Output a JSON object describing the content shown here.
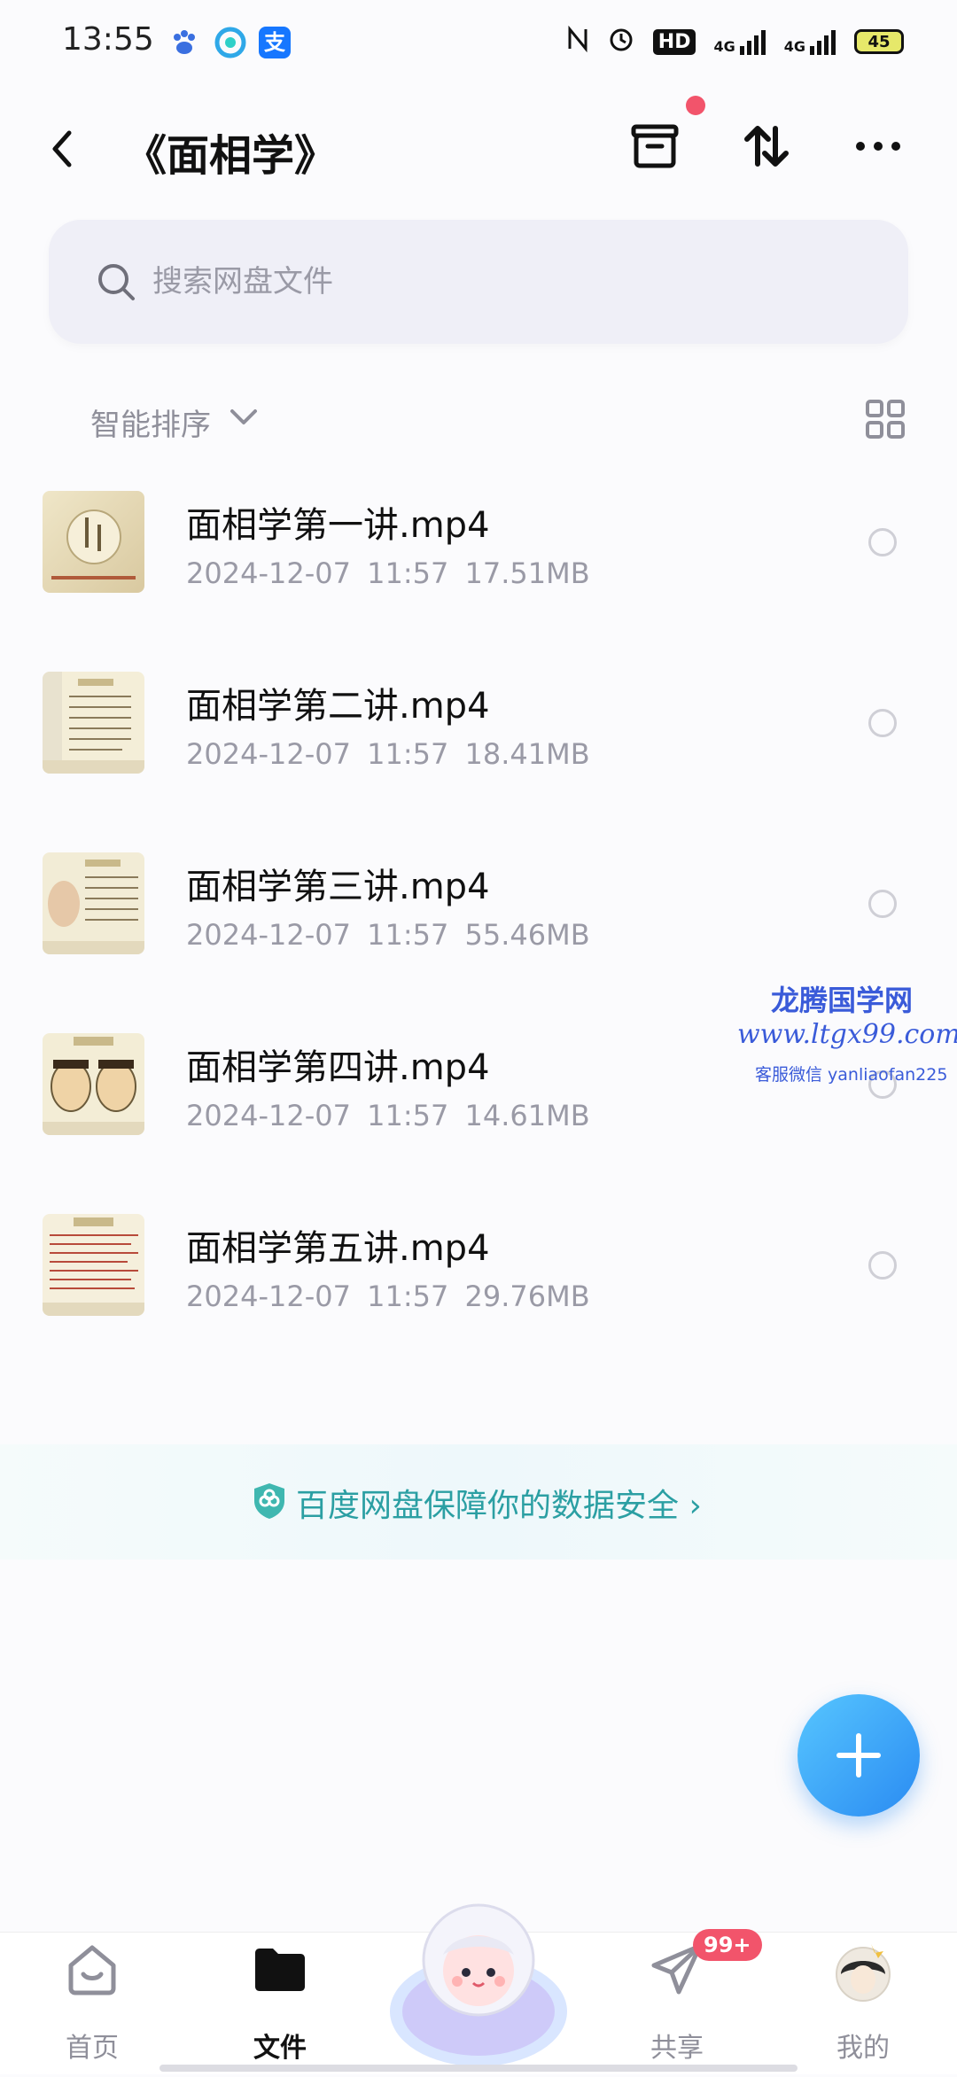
{
  "status_bar": {
    "time": "13:55",
    "hd_label": "HD",
    "net1": "4G",
    "net2": "4G",
    "battery": "45"
  },
  "header": {
    "title": "《面相学》"
  },
  "search": {
    "placeholder": "搜索网盘文件"
  },
  "sort": {
    "label": "智能排序"
  },
  "files": [
    {
      "name": "面相学第一讲.mp4",
      "date": "2024-12-07",
      "time": "11:57",
      "size": "17.51MB"
    },
    {
      "name": "面相学第二讲.mp4",
      "date": "2024-12-07",
      "time": "11:57",
      "size": "18.41MB"
    },
    {
      "name": "面相学第三讲.mp4",
      "date": "2024-12-07",
      "time": "11:57",
      "size": "55.46MB"
    },
    {
      "name": "面相学第四讲.mp4",
      "date": "2024-12-07",
      "time": "11:57",
      "size": "14.61MB"
    },
    {
      "name": "面相学第五讲.mp4",
      "date": "2024-12-07",
      "time": "11:57",
      "size": "29.76MB"
    }
  ],
  "watermark": {
    "title": "龙腾国学网",
    "url": "www.ltgx99.com",
    "contact": "客服微信 yanliaofan225"
  },
  "safety_banner": {
    "text": "百度网盘保障你的数据安全 ›"
  },
  "bottom_nav": {
    "items": [
      {
        "label": "首页"
      },
      {
        "label": "文件"
      },
      {
        "label": "共享",
        "badge": "99+"
      },
      {
        "label": "我的"
      }
    ]
  },
  "colors": {
    "accent_blue": "#2a8bf2",
    "badge_red": "#f2546b",
    "safety_teal": "#2b9fa3",
    "watermark_blue": "#3a5bd9"
  }
}
